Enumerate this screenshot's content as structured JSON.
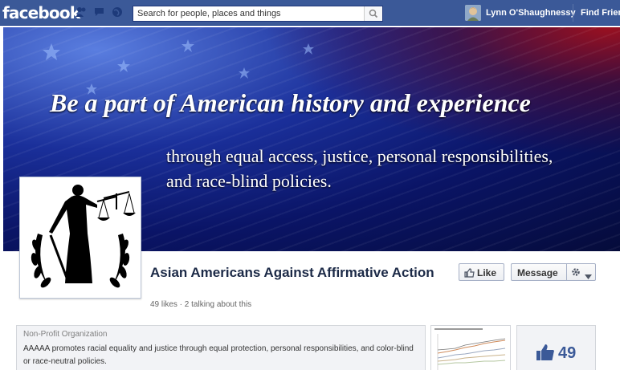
{
  "topbar": {
    "logo": "facebook",
    "search_placeholder": "Search for people, places and things",
    "user_name": "Lynn O'Shaughnessy",
    "find_friends": "Find Frien"
  },
  "cover": {
    "title": "Be a part of American history and experience",
    "subtitle_line1": "through equal access, justice, personal responsibilities,",
    "subtitle_line2": "and race-blind policies."
  },
  "page": {
    "name": "Asian Americans Against Affirmative Action",
    "stats": "49 likes · 2 talking about this",
    "like_label": "Like",
    "message_label": "Message"
  },
  "about": {
    "category": "Non-Profit Organization",
    "description": "AAAAA promotes racial equality and justice through equal protection, personal responsibilities, and color-blind or race-neutral policies."
  },
  "likes_box": {
    "count": "49"
  },
  "colors": {
    "brand": "#3b5998",
    "page_name": "#1c2a47"
  }
}
